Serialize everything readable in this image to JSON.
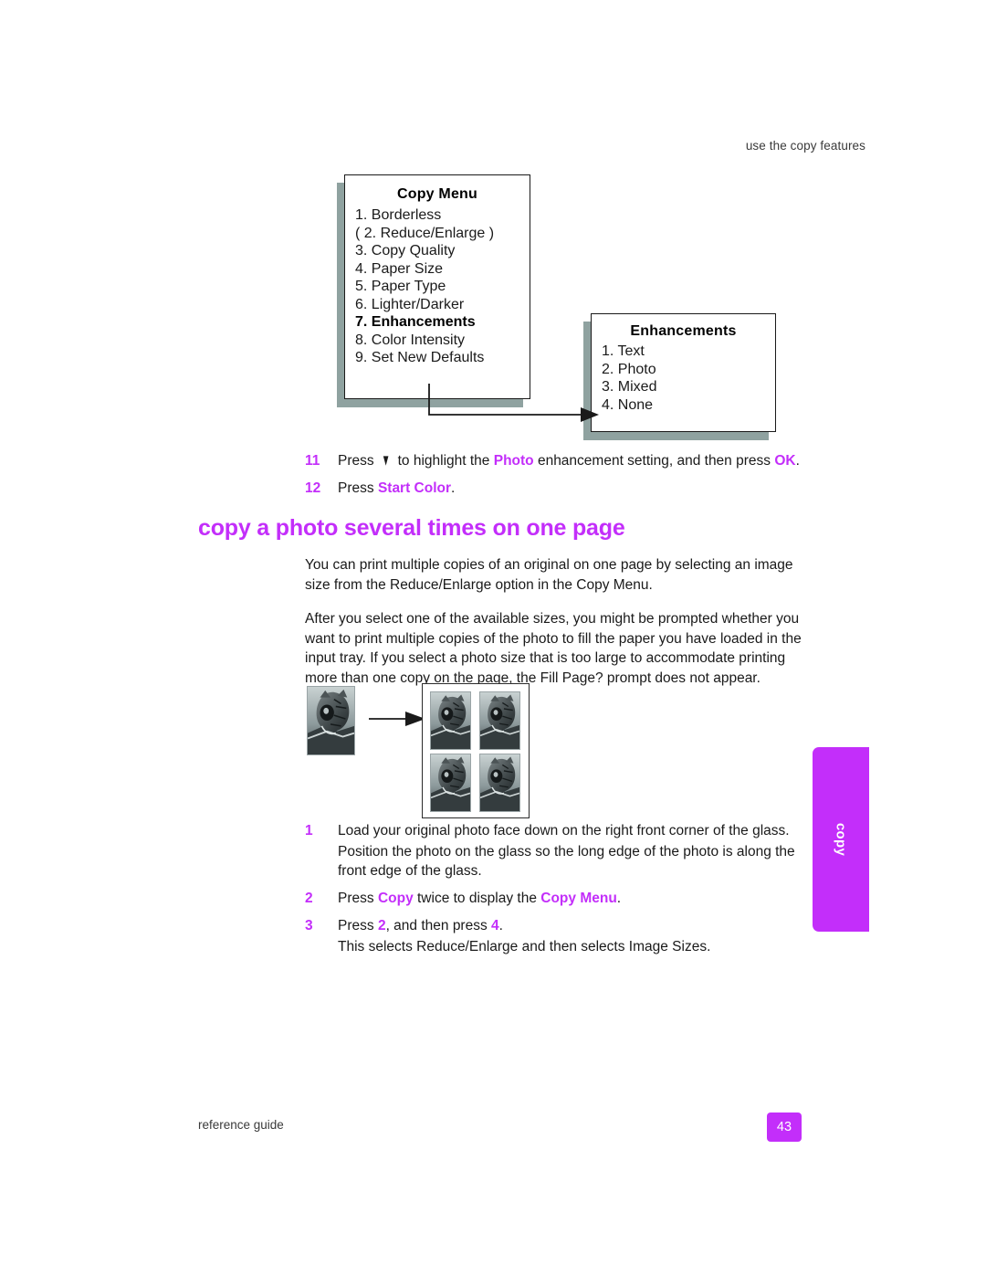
{
  "header": {
    "running_head": "use the copy features"
  },
  "copy_menu": {
    "title": "Copy Menu",
    "items": [
      {
        "label": "1. Borderless",
        "bold": false
      },
      {
        "label": "( 2. Reduce/Enlarge )",
        "bold": false
      },
      {
        "label": "3. Copy Quality",
        "bold": false
      },
      {
        "label": "4. Paper Size",
        "bold": false
      },
      {
        "label": "5. Paper Type",
        "bold": false
      },
      {
        "label": "6. Lighter/Darker",
        "bold": false
      },
      {
        "label": "7. Enhancements",
        "bold": true
      },
      {
        "label": "8. Color Intensity",
        "bold": false
      },
      {
        "label": "9. Set New Defaults",
        "bold": false
      }
    ]
  },
  "enhancements_menu": {
    "title": "Enhancements",
    "items": [
      {
        "label": "1. Text",
        "bold": false
      },
      {
        "label": "2. Photo",
        "bold": false
      },
      {
        "label": "3. Mixed",
        "bold": false
      },
      {
        "label": "4. None",
        "bold": false
      }
    ]
  },
  "steps_top": [
    {
      "num": "11",
      "parts": [
        {
          "text": "Press ",
          "hl": false
        },
        {
          "text": "▼",
          "hl": false,
          "glyph": true
        },
        {
          "text": " to highlight the ",
          "hl": false
        },
        {
          "text": "Photo",
          "hl": true
        },
        {
          "text": " enhancement setting, and then press ",
          "hl": false
        },
        {
          "text": "OK",
          "hl": true
        },
        {
          "text": ".",
          "hl": false
        }
      ]
    },
    {
      "num": "12",
      "parts": [
        {
          "text": "Press ",
          "hl": false
        },
        {
          "text": "Start Color",
          "hl": true
        },
        {
          "text": ".",
          "hl": false
        }
      ]
    }
  ],
  "section": {
    "heading": "copy a photo several times on one page",
    "paragraphs": [
      "You can print multiple copies of an original on one page by selecting an image size from the Reduce/Enlarge option in the Copy Menu.",
      "After you select one of the available sizes, you might be prompted whether you want to print multiple copies of the photo to fill the paper you have loaded in the input tray. If you select a photo size that is too large to accommodate printing more than one copy on the page, the Fill Page? prompt does not appear."
    ]
  },
  "steps_bottom": [
    {
      "num": "1",
      "parts": [
        {
          "text": "Load your original photo face down on the right front corner of the glass.",
          "hl": false
        }
      ],
      "sub": "Position the photo on the glass so the long edge of the photo is along the front edge of the glass."
    },
    {
      "num": "2",
      "parts": [
        {
          "text": "Press ",
          "hl": false
        },
        {
          "text": "Copy",
          "hl": true
        },
        {
          "text": " twice to display the ",
          "hl": false
        },
        {
          "text": "Copy Menu",
          "hl": true
        },
        {
          "text": ".",
          "hl": false
        }
      ],
      "sub": ""
    },
    {
      "num": "3",
      "parts": [
        {
          "text": "Press ",
          "hl": false
        },
        {
          "text": "2",
          "hl": true
        },
        {
          "text": ", and then press ",
          "hl": false
        },
        {
          "text": "4",
          "hl": true
        },
        {
          "text": ".",
          "hl": false
        }
      ],
      "sub": "This selects Reduce/Enlarge and then selects Image Sizes."
    }
  ],
  "side_tab": {
    "label": "copy"
  },
  "footer": {
    "left": "reference guide",
    "page_number": "43"
  },
  "colors": {
    "accent": "#c32efa",
    "box_shadow": "#8fa2a0",
    "text": "#1a1a1a"
  }
}
